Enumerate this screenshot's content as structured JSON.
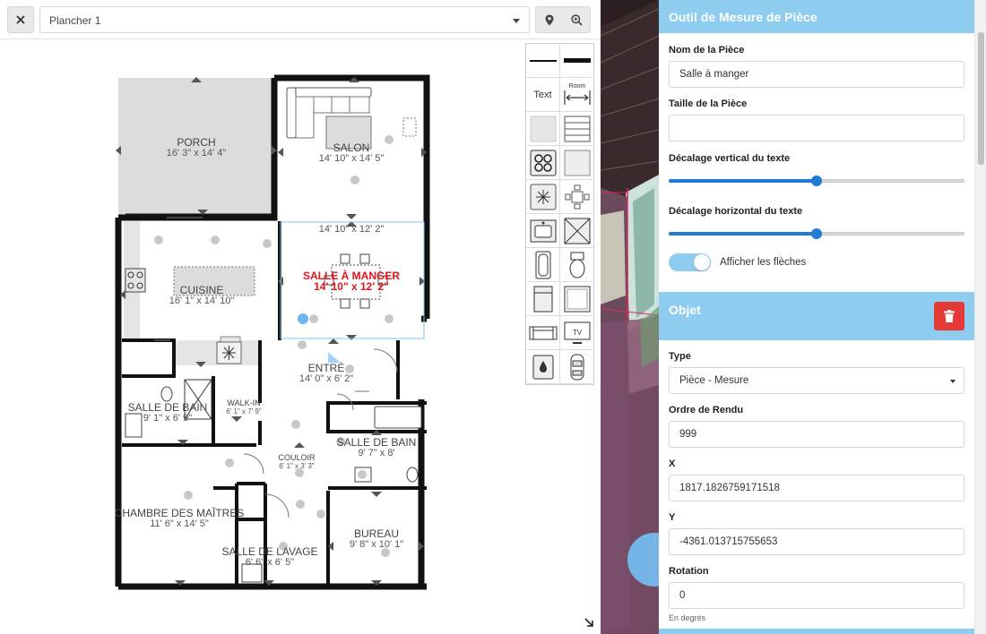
{
  "toolbar": {
    "close_icon": "close-icon",
    "floor_value": "Plancher 1",
    "location_icon": "map-pin-icon",
    "zoom_icon": "zoom-in-icon"
  },
  "plan": {
    "rooms": [
      {
        "id": "porch",
        "name": "PORCH",
        "dims": "16' 3\" x 14' 4\""
      },
      {
        "id": "salon",
        "name": "SALON",
        "dims": "14' 10\" x 14' 5\""
      },
      {
        "id": "salle-a-manger",
        "name": "SALLE À MANGER",
        "dims": "14' 10\" x 12' 2\"",
        "selected": true
      },
      {
        "id": "cuisine",
        "name": "CUISINE",
        "dims": "16' 1\" x 14' 10\""
      },
      {
        "id": "entree",
        "name": "ENTRÉ",
        "dims": "14' 0\" x 6' 2\""
      },
      {
        "id": "sdb1",
        "name": "SALLE DE BAIN",
        "dims": "9' 1\" x 6' 9\""
      },
      {
        "id": "walkin",
        "name": "WALK-IN",
        "dims": "6' 1\" x 7' 9\""
      },
      {
        "id": "sdb2",
        "name": "SALLE DE BAIN",
        "dims": "9' 7\" x 8'"
      },
      {
        "id": "couloir",
        "name": "COULOIR",
        "dims": "6' 1\" x 3' 3\""
      },
      {
        "id": "chambre",
        "name": "CHAMBRE DES MAÎTRES",
        "dims": "11' 6\" x 14' 5\""
      },
      {
        "id": "bureau",
        "name": "BUREAU",
        "dims": "9' 8\" x 10' 1\""
      },
      {
        "id": "lavage",
        "name": "SALLE DE LAVAGE",
        "dims": "6' 6\" x 6' 5\""
      }
    ],
    "measurement_label": "14' 10\" x 12' 2\""
  },
  "palette": {
    "text_label": "Text",
    "room_label": "Room",
    "tv_label": "TV"
  },
  "sidebar": {
    "room_panel": {
      "title": "Outil de Mesure de Pièce",
      "room_name_label": "Nom de la Pièce",
      "room_name_value": "Salle à manger",
      "room_size_label": "Taille de la Pièce",
      "room_size_value": "",
      "vertical_offset_label": "Décalage vertical du texte",
      "vertical_offset_value": 0.5,
      "horizontal_offset_label": "Décalage horizontal du texte",
      "horizontal_offset_value": 0.5,
      "show_arrows_label": "Afficher les flèches",
      "show_arrows_on": true
    },
    "object_panel": {
      "title": "Objet",
      "delete_icon": "trash-icon",
      "type_label": "Type",
      "type_value": "Pièce - Mesure",
      "render_order_label": "Ordre de Rendu",
      "render_order_value": "999",
      "x_label": "X",
      "x_value": "1817.1826759171518",
      "y_label": "Y",
      "y_value": "-4361.013715755653",
      "rotation_label": "Rotation",
      "rotation_value": "0",
      "rotation_hint": "En degrés"
    }
  },
  "colors": {
    "accent": "#8ecdf0",
    "slider": "#1e7ad4",
    "danger": "#e53935",
    "selected_room_text": "#e0161b"
  }
}
